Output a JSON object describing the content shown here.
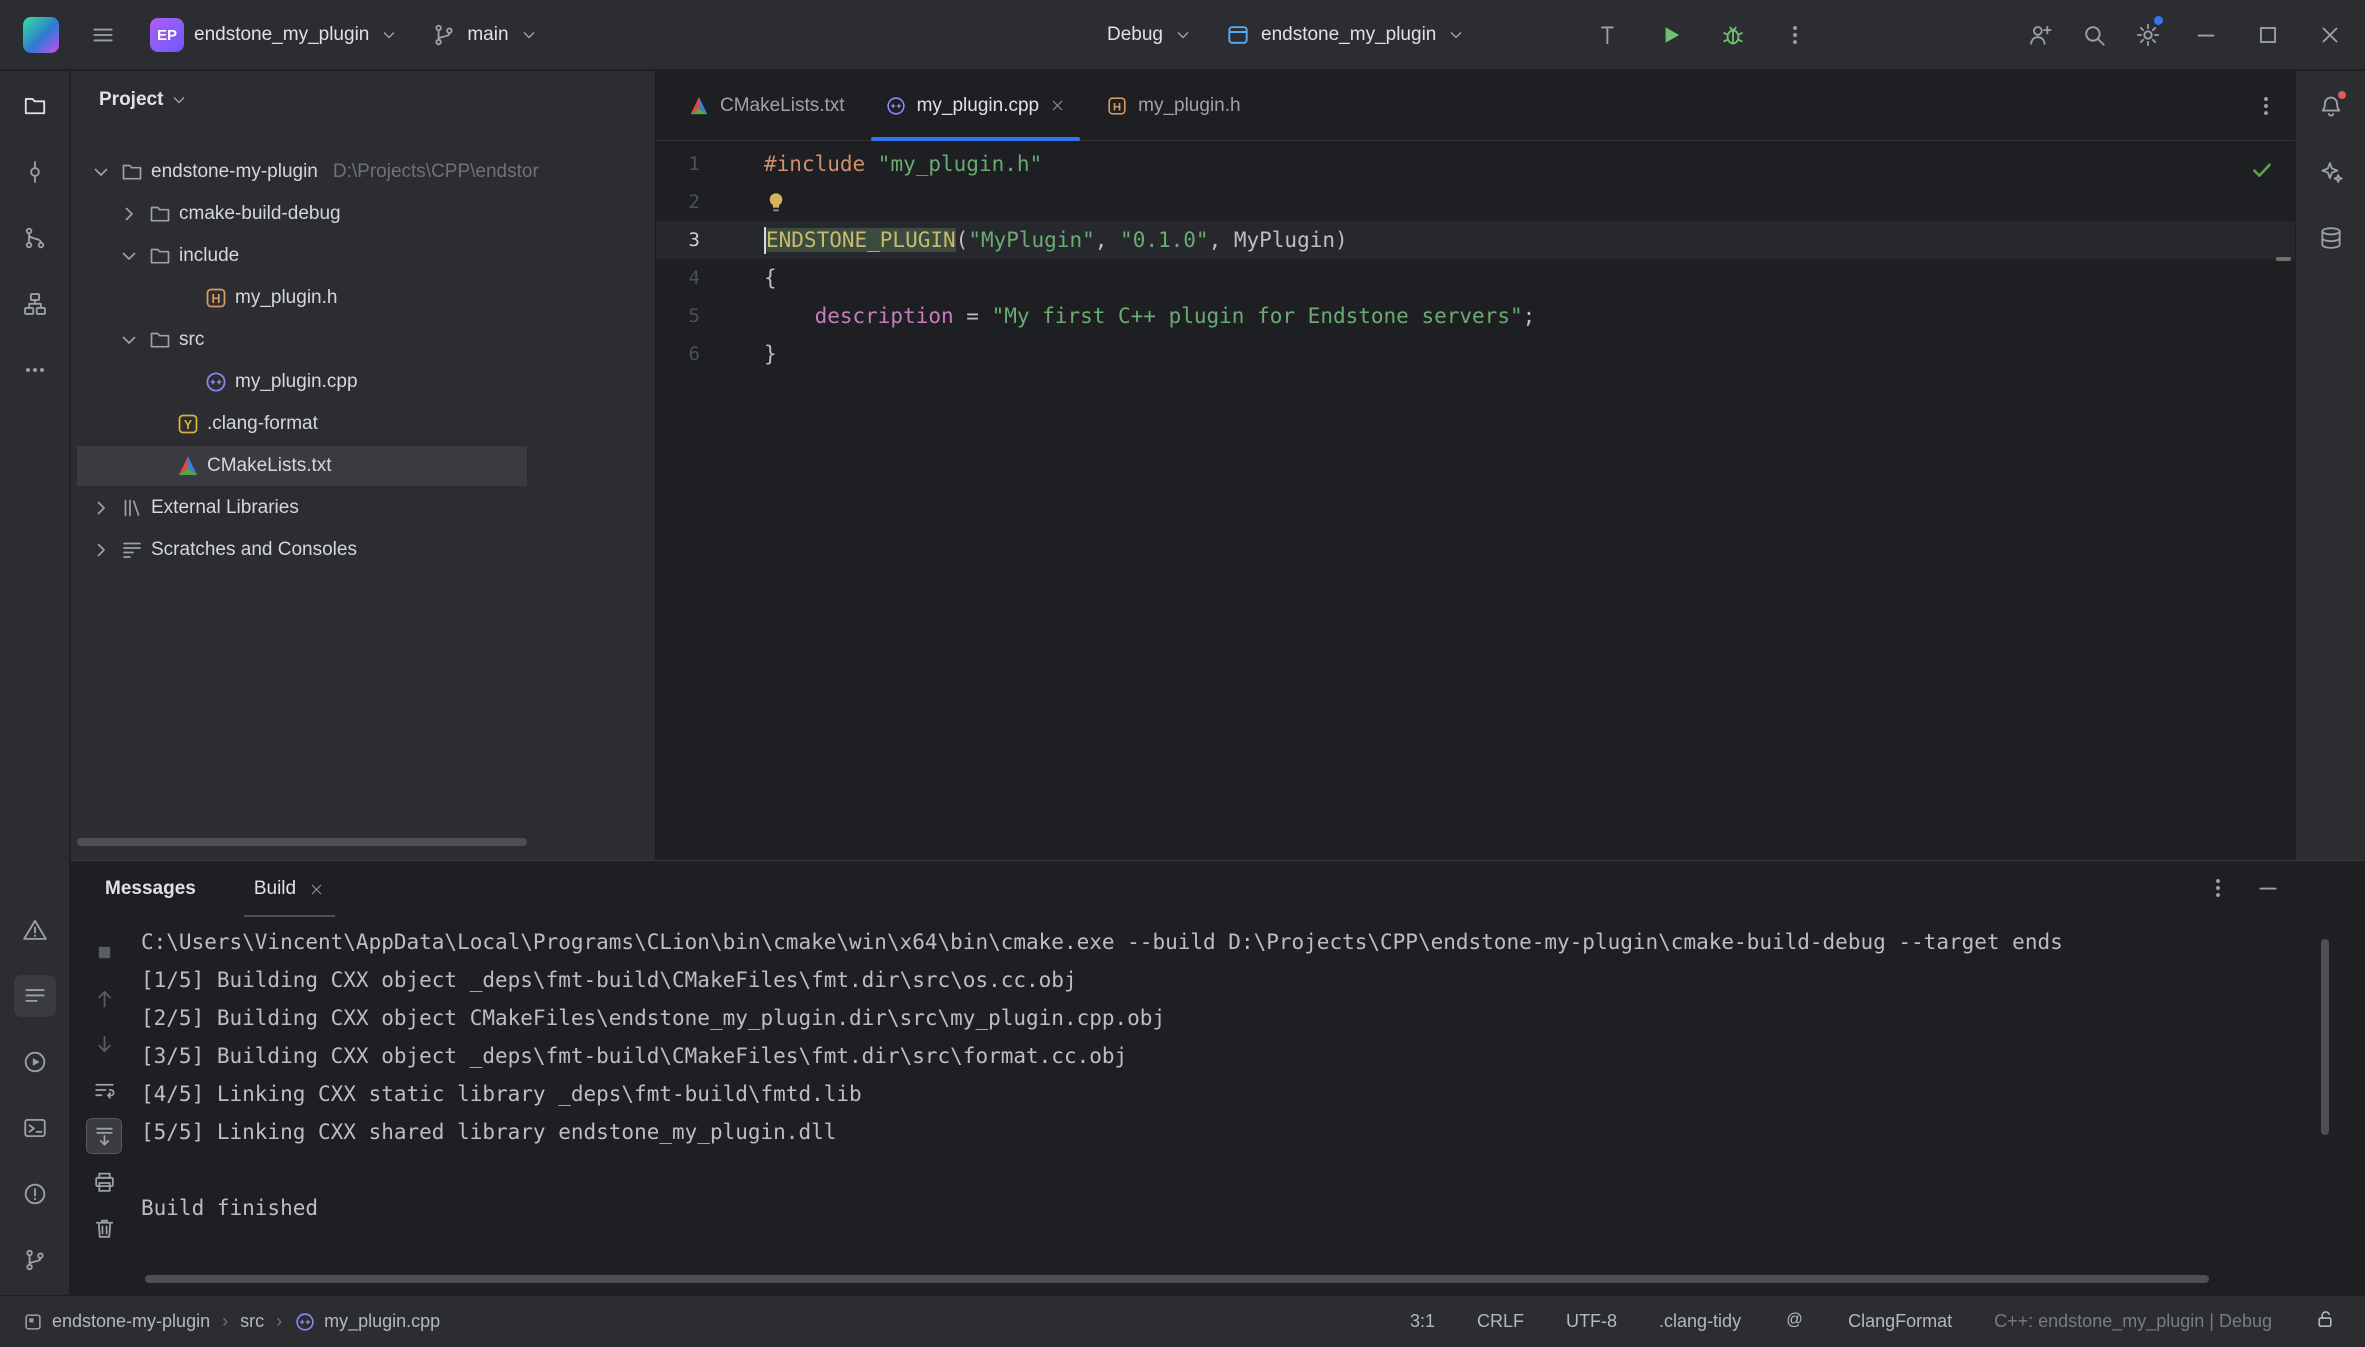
{
  "titlebar": {
    "project_badge": "EP",
    "project_name": "endstone_my_plugin",
    "branch": "main",
    "debug": "Debug",
    "run_config": "endstone_my_plugin"
  },
  "left_stripe": {
    "top": [
      {
        "icon": "folder",
        "name": "project",
        "active": true
      },
      {
        "icon": "commit",
        "name": "commit"
      },
      {
        "icon": "merge",
        "name": "pull-requests"
      },
      {
        "icon": "structure",
        "name": "structure"
      },
      {
        "icon": "more-horizontal",
        "name": "more-tool-windows"
      }
    ],
    "bottom": [
      {
        "icon": "warning-triangle",
        "name": "problems"
      },
      {
        "icon": "lines",
        "name": "messages",
        "selected": true
      },
      {
        "icon": "play-circle",
        "name": "services"
      },
      {
        "icon": "terminal",
        "name": "terminal"
      },
      {
        "icon": "error-circle",
        "name": "inspection-results"
      },
      {
        "icon": "git-branch",
        "name": "git"
      }
    ]
  },
  "right_stripe": [
    {
      "icon": "bell",
      "name": "notifications",
      "dot": true
    },
    {
      "icon": "ai",
      "name": "ai-assistant"
    },
    {
      "icon": "database",
      "name": "database"
    }
  ],
  "project_panel": {
    "title": "Project",
    "tree": [
      {
        "label": "endstone-my-plugin",
        "hint": "D:\\Projects\\CPP\\endstor",
        "icon": "folder",
        "chevron": "down",
        "indent": 0
      },
      {
        "label": "cmake-build-debug",
        "icon": "folder",
        "chevron": "right",
        "indent": 1
      },
      {
        "label": "include",
        "icon": "folder",
        "chevron": "down",
        "indent": 1
      },
      {
        "label": "my_plugin.h",
        "icon": "file-h",
        "indent": 2,
        "file": true
      },
      {
        "label": "src",
        "icon": "folder",
        "chevron": "down",
        "indent": 1
      },
      {
        "label": "my_plugin.cpp",
        "icon": "file-cpp",
        "indent": 2,
        "file": true
      },
      {
        "label": ".clang-format",
        "icon": "file-yaml",
        "indent": 1,
        "file": true
      },
      {
        "label": "CMakeLists.txt",
        "icon": "file-cmake",
        "indent": 1,
        "file": true,
        "selected": true
      },
      {
        "label": "External Libraries",
        "icon": "lib",
        "chevron": "right",
        "indent": 0
      },
      {
        "label": "Scratches and Consoles",
        "icon": "scratch",
        "chevron": "right",
        "indent": 0
      }
    ]
  },
  "editor": {
    "tabs": [
      {
        "label": "CMakeLists.txt",
        "icon": "file-cmake"
      },
      {
        "label": "my_plugin.cpp",
        "icon": "file-cpp",
        "active": true,
        "close": true
      },
      {
        "label": "my_plugin.h",
        "icon": "file-h"
      }
    ],
    "lines": [
      {
        "num": 1,
        "tokens": [
          {
            "t": "#include ",
            "c": "kw"
          },
          {
            "t": "\"my_plugin.h\"",
            "c": "str"
          }
        ]
      },
      {
        "num": 2,
        "bulb": true,
        "tokens": []
      },
      {
        "num": 3,
        "current": true,
        "tokens": [
          {
            "t": "ENDSTONE_PLUGIN",
            "c": "mac",
            "hl": true,
            "caretBefore": true
          },
          {
            "t": "(",
            "c": "def"
          },
          {
            "t": "\"MyPlugin\"",
            "c": "str"
          },
          {
            "t": ", ",
            "c": "def"
          },
          {
            "t": "\"0.1.0\"",
            "c": "str"
          },
          {
            "t": ", MyPlugin)",
            "c": "def"
          }
        ]
      },
      {
        "num": 4,
        "tokens": [
          {
            "t": "{",
            "c": "def"
          }
        ]
      },
      {
        "num": 5,
        "tokens": [
          {
            "t": "    ",
            "c": "def"
          },
          {
            "t": "description",
            "c": "fld"
          },
          {
            "t": " = ",
            "c": "def"
          },
          {
            "t": "\"My first C++ plugin for Endstone servers\"",
            "c": "str"
          },
          {
            "t": ";",
            "c": "def"
          }
        ]
      },
      {
        "num": 6,
        "tokens": [
          {
            "t": "}",
            "c": "def"
          }
        ]
      }
    ]
  },
  "build_panel": {
    "title": "Messages",
    "tab": "Build",
    "toolbar": [
      {
        "icon": "stop",
        "name": "stop",
        "disabled": true
      },
      {
        "icon": "arrow-up",
        "name": "previous-message",
        "disabled": true
      },
      {
        "icon": "arrow-down",
        "name": "next-message",
        "disabled": true
      },
      {
        "icon": "soft-wrap",
        "name": "soft-wrap"
      },
      {
        "icon": "scroll-end",
        "name": "scroll-to-end",
        "selected": true
      },
      {
        "icon": "printer",
        "name": "export"
      },
      {
        "icon": "trash",
        "name": "clear-all"
      }
    ],
    "console": [
      "C:\\Users\\Vincent\\AppData\\Local\\Programs\\CLion\\bin\\cmake\\win\\x64\\bin\\cmake.exe --build D:\\Projects\\CPP\\endstone-my-plugin\\cmake-build-debug --target ends",
      "[1/5] Building CXX object _deps\\fmt-build\\CMakeFiles\\fmt.dir\\src\\os.cc.obj",
      "[2/5] Building CXX object CMakeFiles\\endstone_my_plugin.dir\\src\\my_plugin.cpp.obj",
      "[3/5] Building CXX object _deps\\fmt-build\\CMakeFiles\\fmt.dir\\src\\format.cc.obj",
      "[4/5] Linking CXX static library _deps\\fmt-build\\fmtd.lib",
      "[5/5] Linking CXX shared library endstone_my_plugin.dll",
      "",
      "Build finished"
    ]
  },
  "statusbar": {
    "separator": "›",
    "breadcrumbs": [
      {
        "label": "endstone-my-plugin",
        "icon": "window"
      },
      {
        "label": "src"
      },
      {
        "label": "my_plugin.cpp",
        "icon": "file-cpp"
      }
    ],
    "items": [
      {
        "label": "3:1",
        "name": "caret-position"
      },
      {
        "label": "CRLF",
        "name": "line-separator"
      },
      {
        "label": "UTF-8",
        "name": "encoding"
      },
      {
        "label": ".clang-tidy",
        "name": "clang-tidy"
      },
      {
        "icon": "at",
        "name": "inspection-profile"
      },
      {
        "label": "ClangFormat",
        "name": "clang-format"
      },
      {
        "label": "C++: endstone_my_plugin | Debug",
        "name": "resolve-context",
        "dim": true
      },
      {
        "icon": "unlock",
        "name": "write-access"
      }
    ]
  }
}
